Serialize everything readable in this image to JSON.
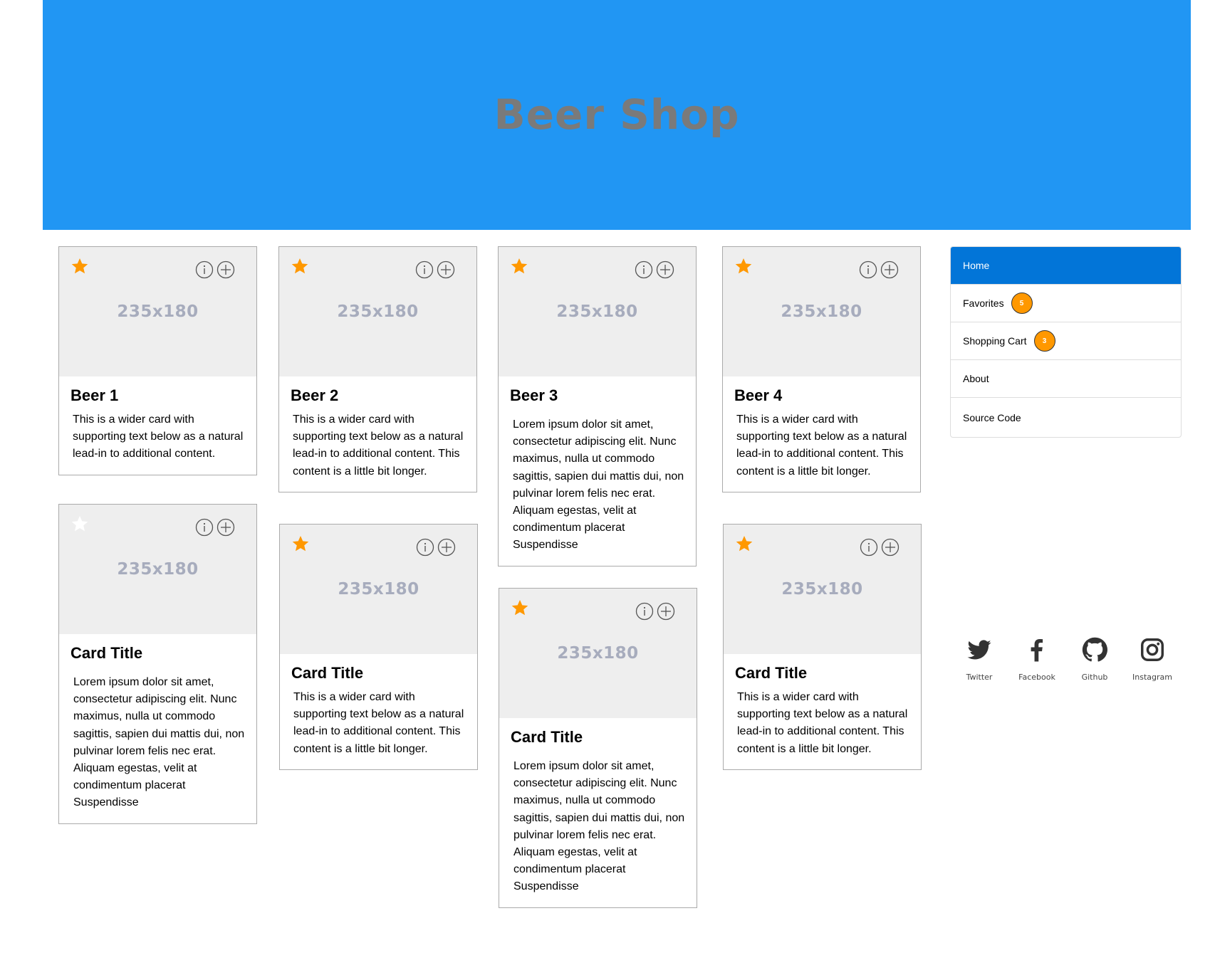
{
  "header": {
    "title": "Beer Shop",
    "background": "#2196f3",
    "title_color": "#7a7a7a"
  },
  "placeholder": "235x180",
  "star_colors": {
    "favorite": "#ff9800",
    "not_favorite": "#ffffff"
  },
  "cards": [
    {
      "title": "Beer 1",
      "favorite": true,
      "text": "This is a wider card with supporting text below as a natural lead-in to additional content."
    },
    {
      "title": "Beer 2",
      "favorite": true,
      "text": "This is a wider card with supporting text below as a natural lead-in to additional content. This content is a little bit longer."
    },
    {
      "title": "Beer 3",
      "favorite": true,
      "text": "Lorem ipsum dolor sit amet, consectetur adipiscing elit. Nunc maximus, nulla ut commodo sagittis, sapien dui mattis dui, non pulvinar lorem felis nec erat. Aliquam egestas, velit at condimentum placerat Suspendisse"
    },
    {
      "title": "Beer 4",
      "favorite": true,
      "text": "This is a wider card with supporting text below as a natural lead-in to additional content. This content is a little bit longer."
    },
    {
      "title": "Card Title",
      "favorite": false,
      "text": "Lorem ipsum dolor sit amet, consectetur adipiscing elit. Nunc maximus, nulla ut commodo sagittis, sapien dui mattis dui, non pulvinar lorem felis nec erat. Aliquam egestas, velit at condimentum placerat Suspendisse"
    },
    {
      "title": "Card Title",
      "favorite": true,
      "text": "This is a wider card with supporting text below as a natural lead-in to additional content. This content is a little bit longer."
    },
    {
      "title": "Card Title",
      "favorite": true,
      "text": "Lorem ipsum dolor sit amet, consectetur adipiscing elit. Nunc maximus, nulla ut commodo sagittis, sapien dui mattis dui, non pulvinar lorem felis nec erat. Aliquam egestas, velit at condimentum placerat Suspendisse"
    },
    {
      "title": "Card Title",
      "favorite": true,
      "text": "This is a wider card with supporting text below as a natural lead-in to additional content. This content is a little bit longer."
    }
  ],
  "card_icons": [
    "star-icon",
    "info-icon",
    "add-circle-icon"
  ],
  "nav": {
    "items": [
      {
        "label": "Home",
        "active": true
      },
      {
        "label": "Favorites",
        "badge": "5"
      },
      {
        "label": "Shopping Cart",
        "badge": "3"
      },
      {
        "label": "About"
      },
      {
        "label": "Source Code"
      }
    ],
    "active_color": "#0275d8",
    "badge_color": "#ff9800"
  },
  "social": [
    {
      "label": "Twitter",
      "icon": "twitter-icon"
    },
    {
      "label": "Facebook",
      "icon": "facebook-icon"
    },
    {
      "label": "Github",
      "icon": "github-icon"
    },
    {
      "label": "Instagram",
      "icon": "instagram-icon"
    }
  ]
}
